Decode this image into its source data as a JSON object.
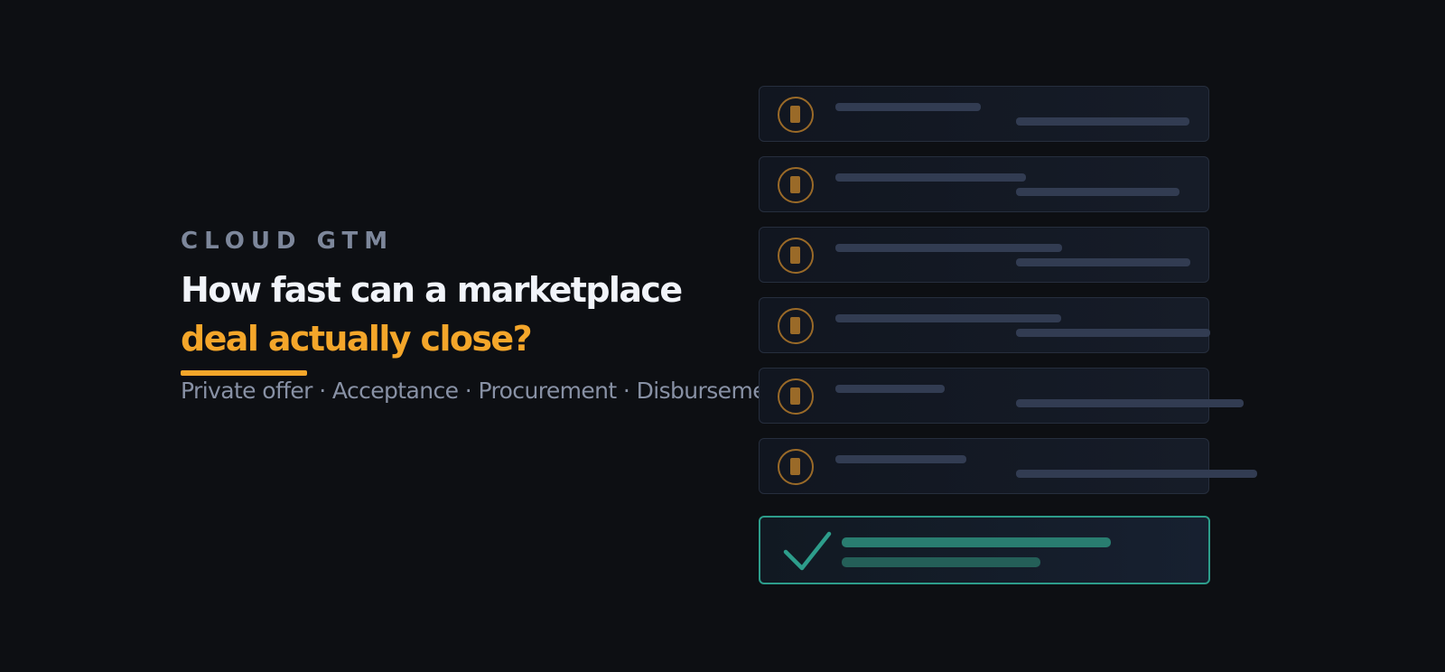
{
  "hero": {
    "eyebrow": "CLOUD GTM",
    "headline_line1": "How fast can a marketplace",
    "headline_line2": "deal actually close?",
    "subtitle": "Private offer · Acceptance · Procurement · Disbursement"
  },
  "timeline": {
    "pending_rows": 6,
    "accent_color": "#f4a62a",
    "pending_icon": "pending-icon",
    "complete_icon": "check-icon",
    "complete_color": "#2d9d8b"
  }
}
